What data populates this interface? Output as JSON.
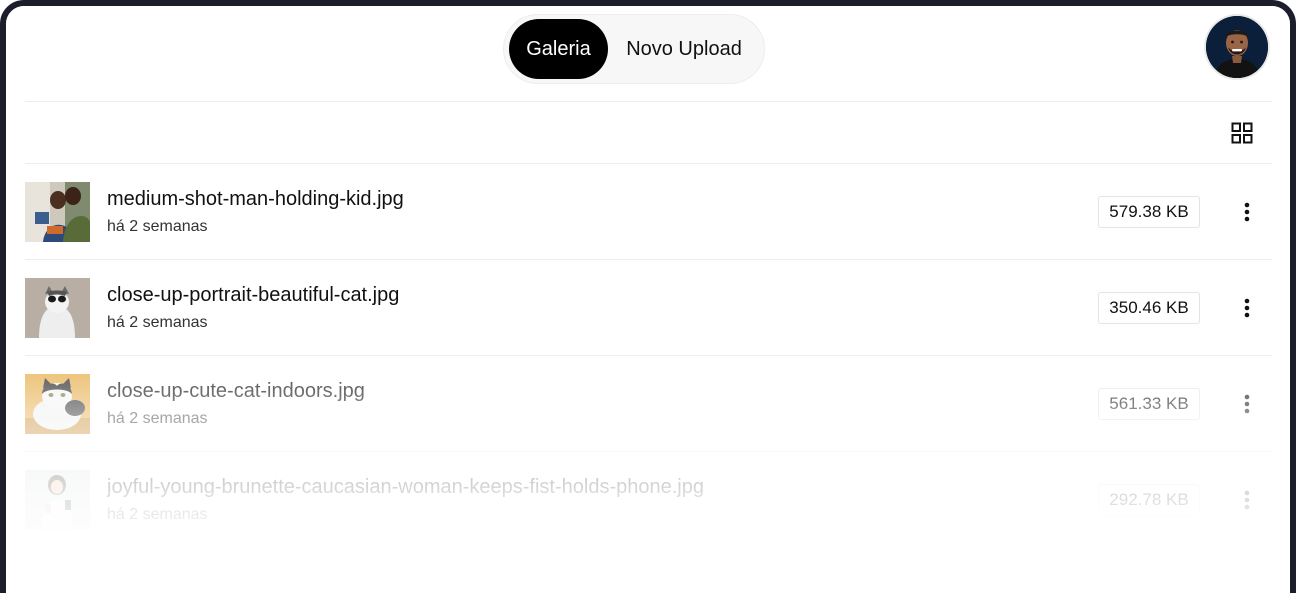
{
  "header": {
    "tabs": [
      {
        "label": "Galeria",
        "active": true
      },
      {
        "label": "Novo Upload",
        "active": false
      }
    ],
    "avatar_icon": "user-avatar"
  },
  "toolbar": {
    "view_toggle_icon": "grid-view-icon"
  },
  "files": [
    {
      "name": "medium-shot-man-holding-kid.jpg",
      "time": "há 2 semanas",
      "size": "579.38 KB"
    },
    {
      "name": "close-up-portrait-beautiful-cat.jpg",
      "time": "há 2 semanas",
      "size": "350.46 KB"
    },
    {
      "name": "close-up-cute-cat-indoors.jpg",
      "time": "há 2 semanas",
      "size": "561.33 KB"
    },
    {
      "name": "joyful-young-brunette-caucasian-woman-keeps-fist-holds-phone.jpg",
      "time": "há 2 semanas",
      "size": "292.78 KB"
    }
  ],
  "colors": {
    "active_tab_bg": "#000000",
    "window_border": "#1c1e2e",
    "avatar_bg": "#0b1e3a"
  }
}
